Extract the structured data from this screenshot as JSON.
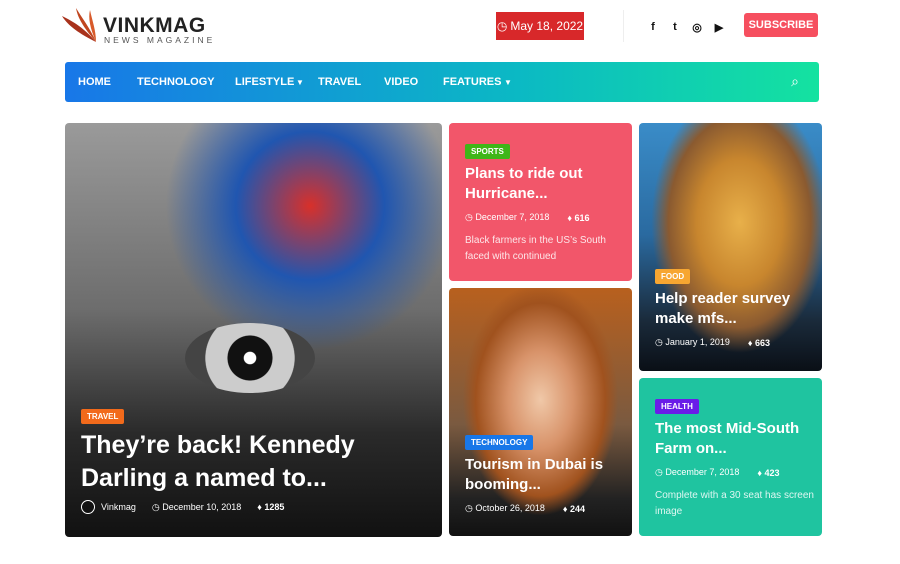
{
  "header": {
    "logo": "VINKMAG",
    "logo_sub": "NEWS MAGAZINE",
    "date": "May 18, 2022",
    "subscribe": "SUBSCRIBE",
    "social": [
      {
        "icon": "facebook-icon",
        "glyph": "f"
      },
      {
        "icon": "twitter-icon",
        "glyph": "t"
      },
      {
        "icon": "instagram-icon",
        "glyph": "◎"
      },
      {
        "icon": "youtube-icon",
        "glyph": "▶"
      }
    ]
  },
  "nav": {
    "items": [
      "HOME",
      "TECHNOLOGY",
      "LIFESTYLE",
      "TRAVEL",
      "VIDEO",
      "FEATURES"
    ],
    "dropdowns": [
      "LIFESTYLE",
      "FEATURES"
    ],
    "colors": [
      "#1877e8",
      "#14e2a0"
    ]
  },
  "posts": [
    {
      "category": "TRAVEL",
      "category_color": "#f26a1b",
      "title": "They’re back! Kennedy Darling a named to...",
      "author": "Vinkmag",
      "date": "December 10, 2018",
      "views": "1285"
    },
    {
      "category": "SPORTS",
      "category_color": "#3fb618",
      "title": "Plans to ride out Hurricane...",
      "date": "December 7, 2018",
      "views": "616",
      "excerpt": "Black farmers in the US’s South faced with continued"
    },
    {
      "category": "FOOD",
      "category_color": "#f7a631",
      "title": "Help reader survey make mfs...",
      "date": "January 1, 2019",
      "views": "663"
    },
    {
      "category": "TECHNOLOGY",
      "category_color": "#1877e8",
      "title": "Tourism in Dubai is booming...",
      "date": "October 26, 2018",
      "views": "244"
    },
    {
      "category": "HEALTH",
      "category_color": "#6a1de8",
      "title": "The most Mid-South Farm on...",
      "date": "December 7, 2018",
      "views": "423",
      "excerpt": "Complete with a 30 seat has screen image"
    }
  ]
}
